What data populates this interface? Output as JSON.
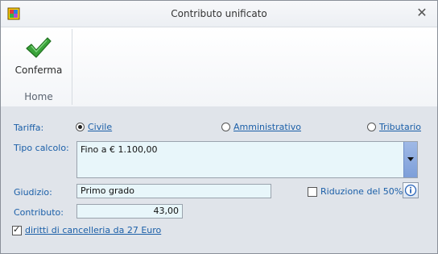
{
  "window": {
    "title": "Contributo unificato"
  },
  "ribbon": {
    "confirm_label": "Conferma",
    "group_label": "Home"
  },
  "form": {
    "tariffa": {
      "label": "Tariffa:",
      "options": [
        {
          "label": "Civile",
          "selected": true
        },
        {
          "label": "Amministrativo",
          "selected": false
        },
        {
          "label": "Tributario",
          "selected": false
        }
      ]
    },
    "tipo_calcolo": {
      "label": "Tipo calcolo:",
      "value": "Fino a € 1.100,00"
    },
    "giudizio": {
      "label": "Giudizio:",
      "value": "Primo grado"
    },
    "riduzione": {
      "label": "Riduzione del 50%",
      "checked": false
    },
    "contributo": {
      "label": "Contributo:",
      "value": "43,00"
    },
    "diritti": {
      "label": "diritti di cancelleria da 27 Euro",
      "checked": true
    }
  },
  "icons": {
    "app": "app-colorful-icon",
    "confirm": "checkmark-icon",
    "info": "info-icon",
    "close": "close-icon"
  },
  "colors": {
    "label_blue": "#1b5fa8",
    "field_bg": "#e8f6fa",
    "check_green": "#3aa33a"
  }
}
